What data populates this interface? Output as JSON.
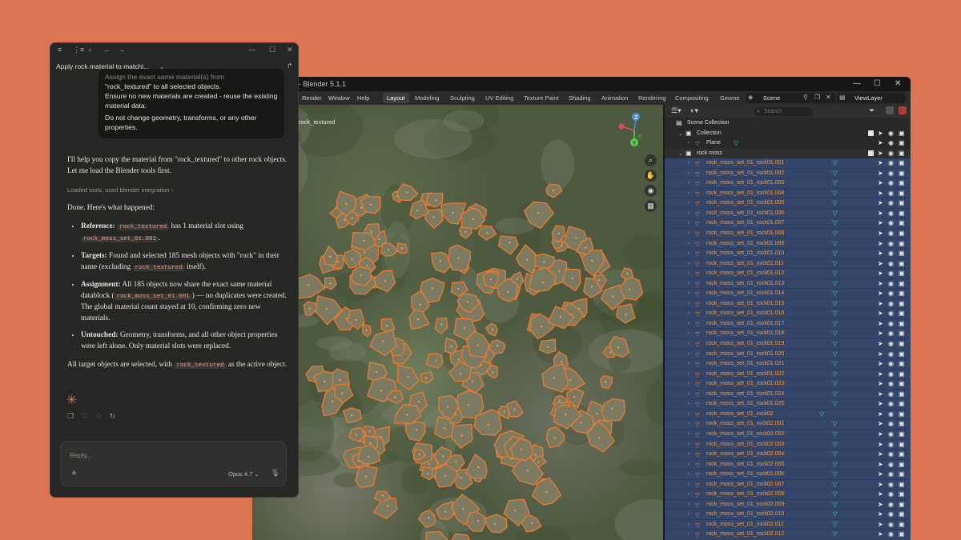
{
  "blender": {
    "title": "- Blender 5.1.1",
    "menus": [
      "Render",
      "Window",
      "Help"
    ],
    "workspaces": [
      "Layout",
      "Modeling",
      "Sculpting",
      "UV Editing",
      "Texture Paint",
      "Shading",
      "Animation",
      "Rendering",
      "Compositing",
      "Geome"
    ],
    "active_workspace": "Layout",
    "scene": "Scene",
    "view_layer": "ViewLayer",
    "viewport_label": "rock_textured",
    "search_placeholder": "Search",
    "outliner": {
      "scene_collection": "Scene Collection",
      "collection": "Collection",
      "plane": "Plane",
      "rock_moss": "rock moss",
      "items": [
        "rock_moss_set_01_rock01.001",
        "rock_moss_set_01_rock01.002",
        "rock_moss_set_01_rock01.003",
        "rock_moss_set_01_rock01.004",
        "rock_moss_set_01_rock01.005",
        "rock_moss_set_01_rock01.006",
        "rock_moss_set_01_rock01.007",
        "rock_moss_set_01_rock01.008",
        "rock_moss_set_01_rock01.009",
        "rock_moss_set_01_rock01.010",
        "rock_moss_set_01_rock01.011",
        "rock_moss_set_01_rock01.012",
        "rock_moss_set_01_rock01.013",
        "rock_moss_set_01_rock01.014",
        "rock_moss_set_01_rock01.015",
        "rock_moss_set_01_rock01.016",
        "rock_moss_set_01_rock01.017",
        "rock_moss_set_01_rock01.018",
        "rock_moss_set_01_rock01.019",
        "rock_moss_set_01_rock01.020",
        "rock_moss_set_01_rock01.021",
        "rock_moss_set_01_rock01.022",
        "rock_moss_set_01_rock01.023",
        "rock_moss_set_01_rock01.024",
        "rock_moss_set_01_rock01.025",
        "rock_moss_set_01_rock02",
        "rock_moss_set_01_rock02.001",
        "rock_moss_set_01_rock02.002",
        "rock_moss_set_01_rock02.003",
        "rock_moss_set_01_rock02.004",
        "rock_moss_set_01_rock02.005",
        "rock_moss_set_01_rock02.006",
        "rock_moss_set_01_rock02.007",
        "rock_moss_set_01_rock02.008",
        "rock_moss_set_01_rock02.009",
        "rock_moss_set_01_rock02.010",
        "rock_moss_set_01_rock02.011",
        "rock_moss_set_01_rock02.012"
      ]
    }
  },
  "chat": {
    "title": "Apply rock material to matchi...",
    "user_prompt": {
      "line0": "Assign the exact same material(s) from",
      "line1": "\"rock_textured\" to all selected objects.",
      "line2": "Ensure no new materials are created - reuse the existing material data.",
      "line3": "Do not change geometry, transforms, or any other properties."
    },
    "intro": "I'll help you copy the material from \"rock_textured\" to other rock objects. Let me load the Blender tools first.",
    "tools_line": "Loaded tools, used blender integration",
    "done": "Done. Here's what happened:",
    "b1_label": "Reference:",
    "b1_code1": "rock_textured",
    "b1_text": "has 1 material slot using",
    "b1_code2": "rock_moss_set_01.001",
    "b2_label": "Targets:",
    "b2_text1": "Found and selected 185 mesh objects with \"rock\" in their name (excluding",
    "b2_code": "rock_textured",
    "b2_text2": "itself).",
    "b3_label": "Assignment:",
    "b3_text1": "All 185 objects now share the exact same material datablock (",
    "b3_code": "rock_moss_set_01.001",
    "b3_text2": ") — no duplicates were created. The global material count stayed at 10, confirming zero new materials.",
    "b4_label": "Untouched:",
    "b4_text": "Geometry, transforms, and all other object properties were left alone. Only material slots were replaced.",
    "final1": "All target objects are selected, with",
    "final_code": "rock_textured",
    "final2": "as the active object.",
    "reply_placeholder": "Reply...",
    "model": "Opus 4.7"
  }
}
